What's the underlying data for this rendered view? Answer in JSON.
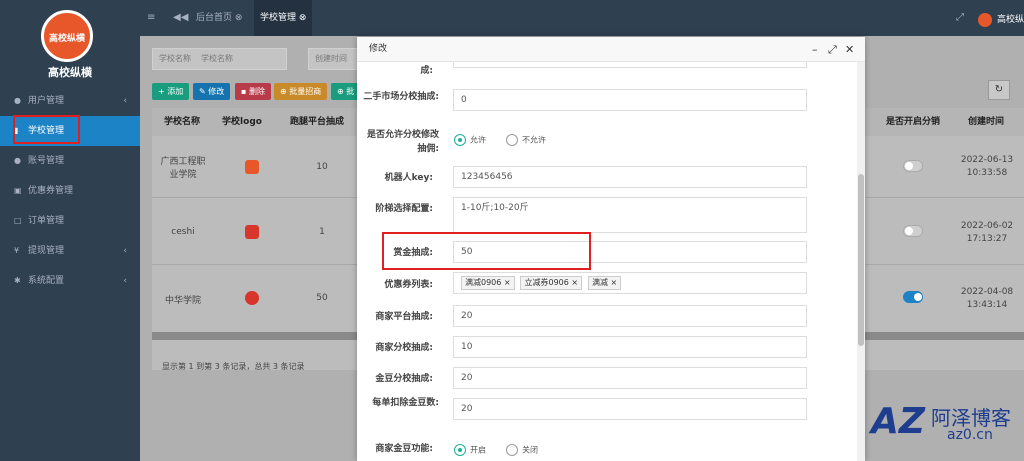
{
  "sidebar": {
    "logo_text": "高校纵横",
    "brand": "高校纵横",
    "items": [
      {
        "label": "用户管理",
        "icon": "user-icon",
        "chev": "‹"
      },
      {
        "label": "学校管理",
        "icon": "school-icon",
        "chev": ""
      },
      {
        "label": "账号管理",
        "icon": "users-icon",
        "chev": ""
      },
      {
        "label": "优惠券管理",
        "icon": "coupon-icon",
        "chev": ""
      },
      {
        "label": "订单管理",
        "icon": "order-icon",
        "chev": ""
      },
      {
        "label": "提现管理",
        "icon": "yen-icon",
        "chev": "‹"
      },
      {
        "label": "系统配置",
        "icon": "gear-icon",
        "chev": "‹"
      }
    ]
  },
  "topbar": {
    "tab_home": "后台首页",
    "tab_active": "学校管理",
    "user": "高校纵"
  },
  "search": {
    "school_label": "学校名称",
    "school_placeholder": "学校名称",
    "date_label": "创建时间"
  },
  "toolbar": {
    "add": "添加",
    "edit": "修改",
    "delete": "删除",
    "batch": "批量招商",
    "more": "批"
  },
  "table": {
    "headers": [
      "学校名称",
      "学校logo",
      "跑腿平台抽成",
      "是否开启分销",
      "创建时间"
    ],
    "rows": [
      {
        "name": "广西工程职业学院",
        "fee": "10",
        "date": "2022-06-13",
        "time": "10:33:58",
        "toggle": false
      },
      {
        "name": "ceshi",
        "fee": "1",
        "date": "2022-06-02",
        "time": "17:13:27",
        "toggle": false
      },
      {
        "name": "中华学院",
        "fee": "50",
        "date": "2022-04-08",
        "time": "13:43:14",
        "toggle": true
      }
    ],
    "footer": "显示第 1 到第 3 条记录，总共 3 条记录"
  },
  "modal": {
    "title": "修改",
    "cut_label": "成:",
    "market_label": "二手市场分校抽成:",
    "market_value": "0",
    "allow_label": "是否允许分校修改抽佣:",
    "allow_yes": "允许",
    "allow_no": "不允许",
    "robot_label": "机器人key:",
    "robot_value": "123456456",
    "tier_label": "阶梯选择配置:",
    "tier_value": "1-10斤;10-20斤",
    "bounty_label": "赏金抽成:",
    "bounty_value": "50",
    "coupon_label": "优惠券列表:",
    "coupons": [
      "满减0906",
      "立减券0906",
      "满减"
    ],
    "mp_label": "商家平台抽成:",
    "mp_value": "20",
    "ms_label": "商家分校抽成:",
    "ms_value": "10",
    "gold_label": "金豆分校抽成:",
    "gold_value": "20",
    "deduct_label": "每单扣除金豆数:",
    "deduct_value": "20",
    "gold_fn_label": "商家金豆功能:",
    "gold_on": "开启",
    "gold_off": "关闭"
  },
  "watermark": {
    "logo": "AZ",
    "t1": "阿泽博客",
    "t2": "az0.cn"
  },
  "colors": {
    "sidebar": "#2f4050",
    "active": "#1c84c6",
    "highlight": "#e02020",
    "radio": "#1ab394"
  }
}
